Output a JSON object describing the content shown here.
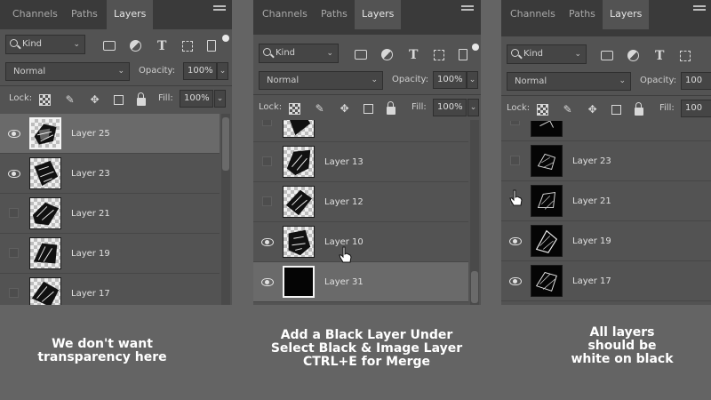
{
  "panels": [
    {
      "tabs": [
        "Channels",
        "Paths",
        "Layers"
      ],
      "active_tab": "Layers",
      "kind": "Kind",
      "blend_mode": "Normal",
      "opacity_label": "Opacity:",
      "opacity_value": "100%",
      "lock_label": "Lock:",
      "fill_label": "Fill:",
      "fill_value": "100%",
      "layers": [
        {
          "name": "Layer 25",
          "visible": true,
          "selected": true
        },
        {
          "name": "Layer 23",
          "visible": true,
          "selected": false
        },
        {
          "name": "Layer 21",
          "visible": false,
          "selected": false
        },
        {
          "name": "Layer 19",
          "visible": false,
          "selected": false
        },
        {
          "name": "Layer 17",
          "visible": false,
          "selected": false
        }
      ]
    },
    {
      "tabs": [
        "Channels",
        "Paths",
        "Layers"
      ],
      "active_tab": "Layers",
      "kind": "Kind",
      "blend_mode": "Normal",
      "opacity_label": "Opacity:",
      "opacity_value": "100%",
      "lock_label": "Lock:",
      "fill_label": "Fill:",
      "fill_value": "100%",
      "layers": [
        {
          "name": "",
          "visible": false,
          "selected": false
        },
        {
          "name": "Layer 13",
          "visible": false,
          "selected": false
        },
        {
          "name": "Layer 12",
          "visible": false,
          "selected": false
        },
        {
          "name": "Layer 10",
          "visible": true,
          "selected": false
        },
        {
          "name": "Layer 31",
          "visible": true,
          "selected": true
        }
      ]
    },
    {
      "tabs": [
        "Channels",
        "Paths",
        "Layers"
      ],
      "active_tab": "Layers",
      "kind": "Kind",
      "blend_mode": "Normal",
      "opacity_label": "Opacity:",
      "opacity_value": "100",
      "lock_label": "Lock:",
      "fill_label": "Fill:",
      "fill_value": "100",
      "layers": [
        {
          "name": "",
          "visible": false,
          "selected": false
        },
        {
          "name": "Layer 23",
          "visible": false,
          "selected": false
        },
        {
          "name": "Layer 21",
          "visible": false,
          "selected": false
        },
        {
          "name": "Layer 19",
          "visible": true,
          "selected": false
        },
        {
          "name": "Layer 17",
          "visible": true,
          "selected": false
        }
      ]
    }
  ],
  "captions": [
    [
      "We don't want",
      "transparency here"
    ],
    [
      "Add a Black Layer Under",
      "Select Black & Image Layer",
      "CTRL+E for Merge"
    ],
    [
      "All layers",
      "should be",
      "white on black"
    ]
  ],
  "colors": {
    "background": "#646464",
    "panel": "#535353",
    "tab_bar": "#3a3a3a",
    "selected_row": "#6a6a6a",
    "caption_text": "#ffffff"
  },
  "icons": [
    "search-icon",
    "image-filter-icon",
    "adjustment-filter-icon",
    "type-filter-icon",
    "shape-filter-icon",
    "smart-object-filter-icon",
    "panel-menu-icon",
    "lock-pixels-icon",
    "brush-icon",
    "move-icon",
    "artboard-icon",
    "lock-all-icon",
    "eye-icon",
    "hand-cursor-icon"
  ]
}
